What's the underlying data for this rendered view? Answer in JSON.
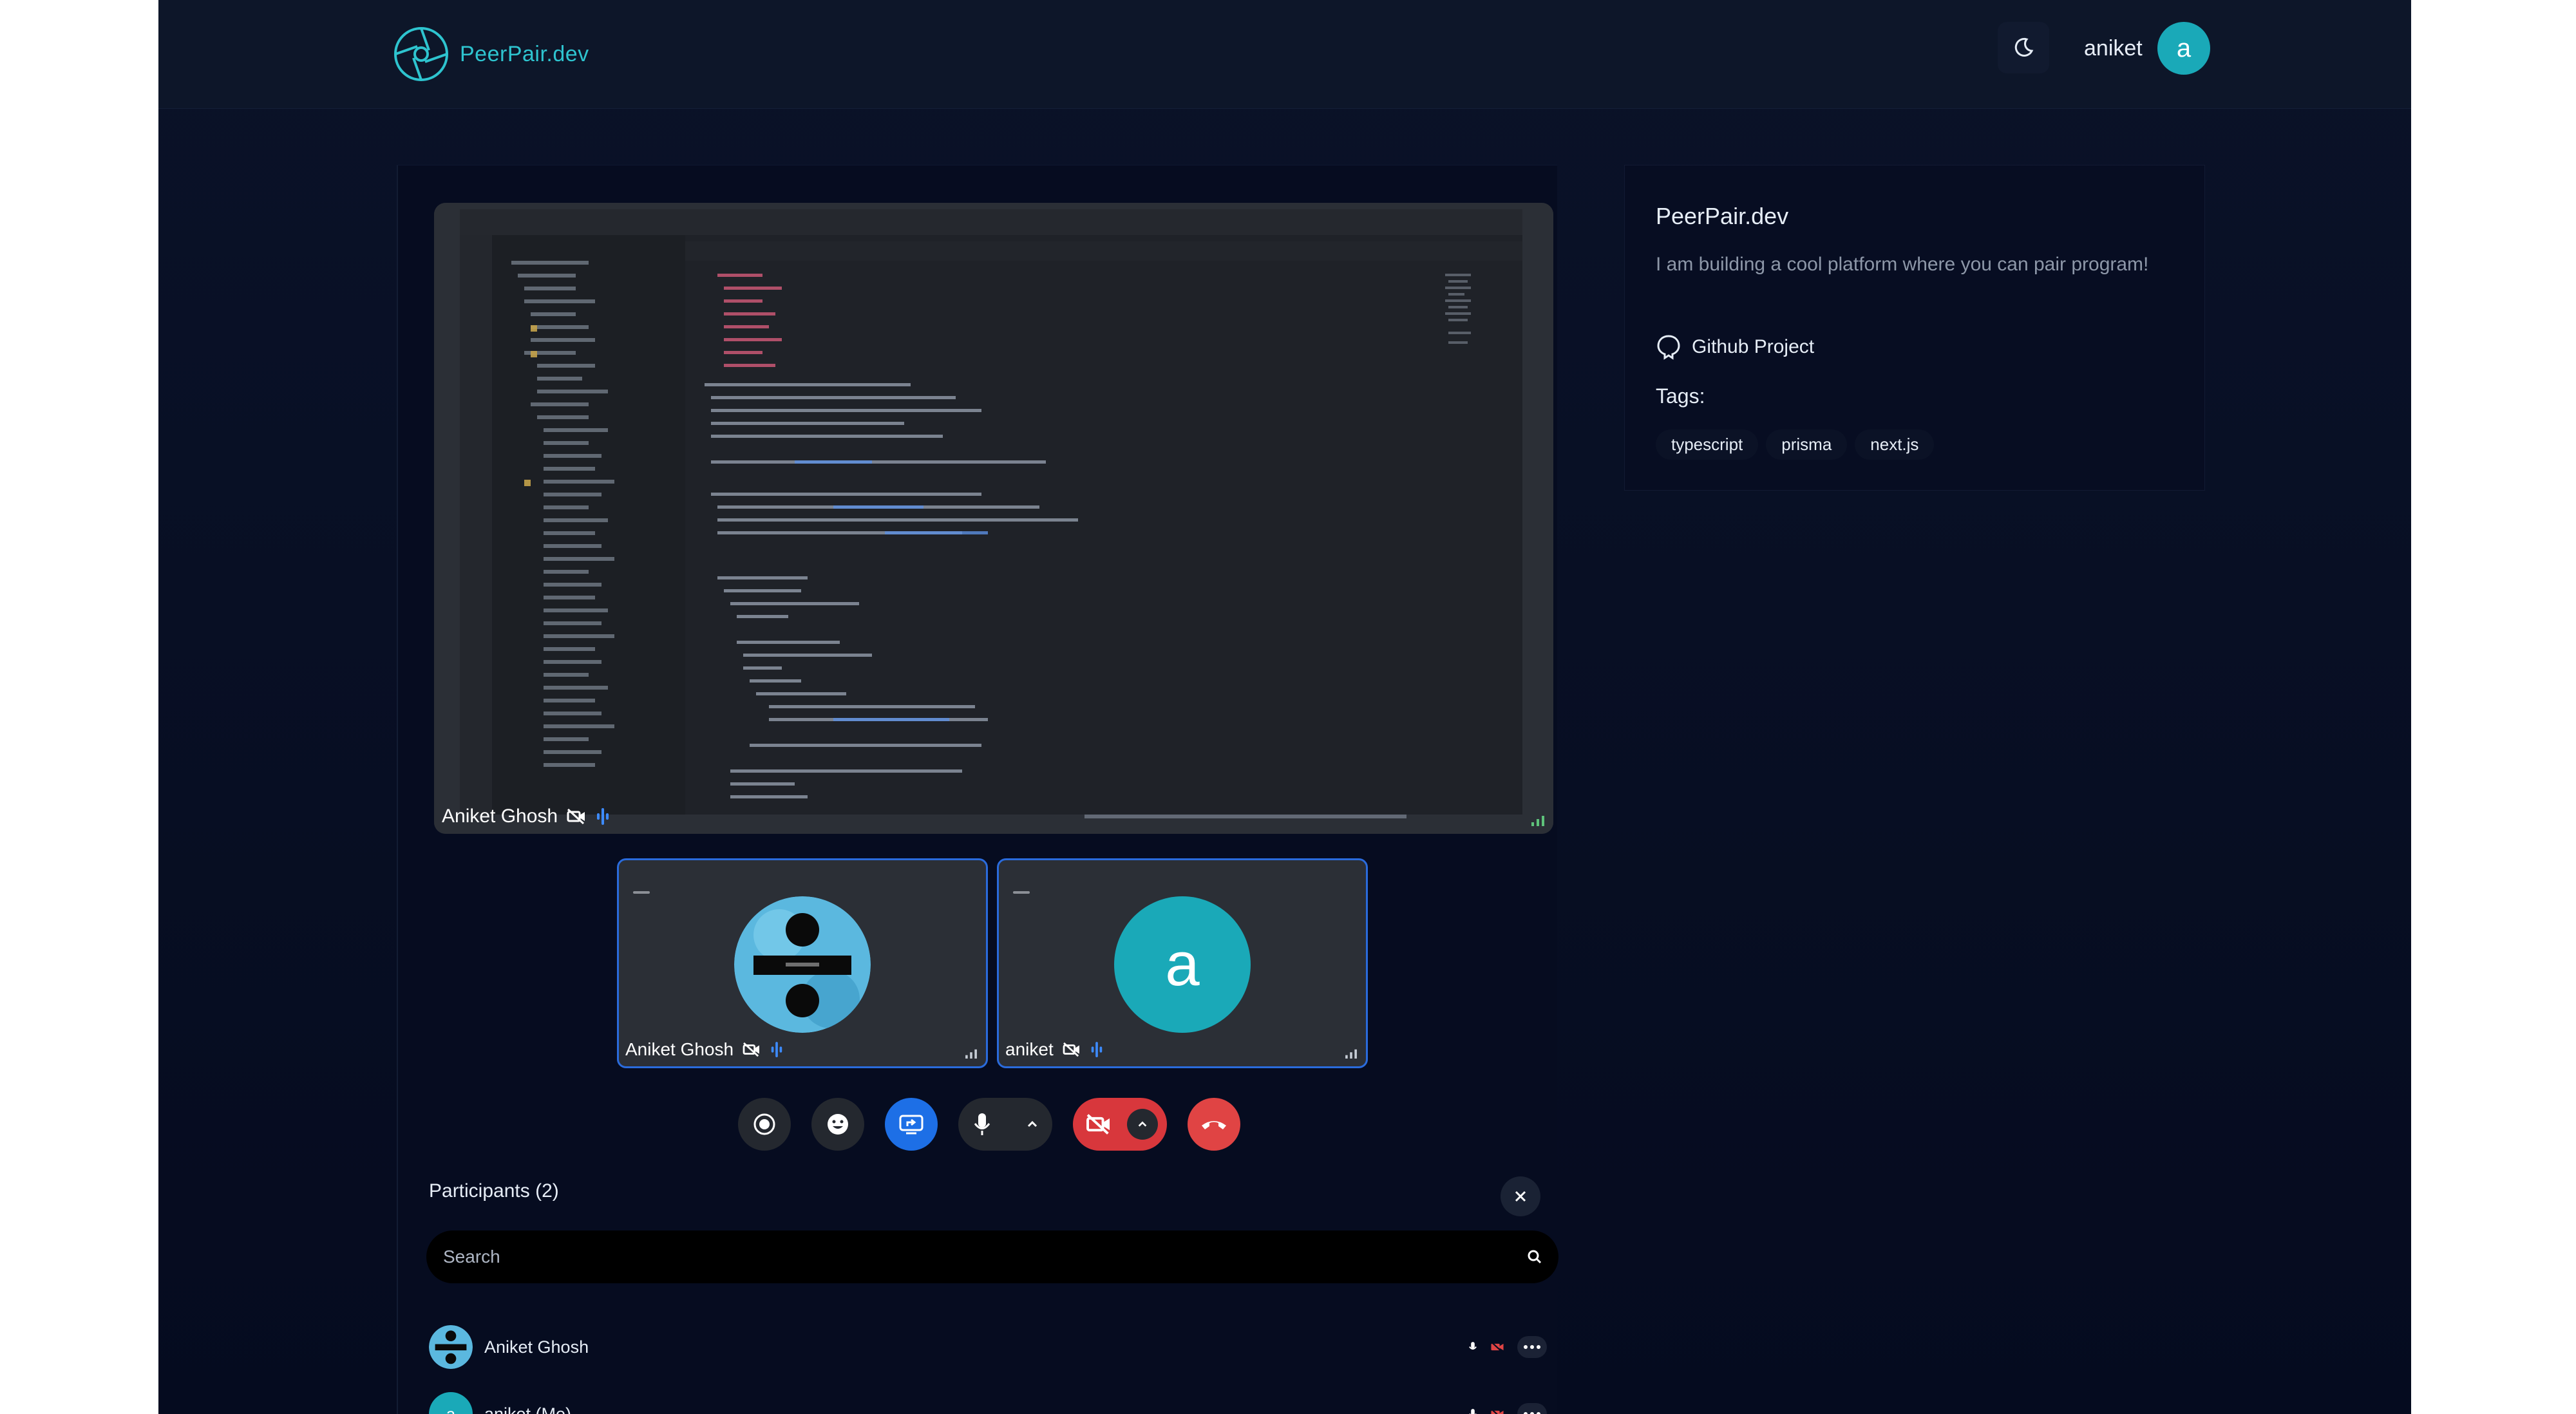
{
  "header": {
    "brand": "PeerPair.dev",
    "username": "aniket",
    "avatar_letter": "a",
    "theme_icon": "moon-icon"
  },
  "call": {
    "screen_share": {
      "presenter": "Aniket Ghosh"
    },
    "tiles": [
      {
        "name": "Aniket Ghosh"
      },
      {
        "name": "aniket",
        "avatar_letter": "a"
      }
    ],
    "controls": [
      "record-icon",
      "emoji-icon",
      "screen-share-icon",
      "microphone-icon",
      "camera-off-icon",
      "hang-up-icon"
    ]
  },
  "participants": {
    "title": "Participants (2)",
    "search_placeholder": "Search",
    "list": [
      {
        "name": "Aniket Ghosh"
      },
      {
        "name": "aniket (Me)",
        "avatar_letter": "a"
      }
    ]
  },
  "project": {
    "title": "PeerPair.dev",
    "description": "I am building a cool platform where you can pair program!",
    "github_label": "Github Project",
    "tags_label": "Tags:",
    "tags": [
      "typescript",
      "prisma",
      "next.js"
    ]
  },
  "colors": {
    "accent": "#2ec4cf",
    "teal_avatar": "#1aa9b8",
    "primary_blue": "#1d6fe6",
    "danger": "#e04444",
    "background": "#060c20"
  }
}
